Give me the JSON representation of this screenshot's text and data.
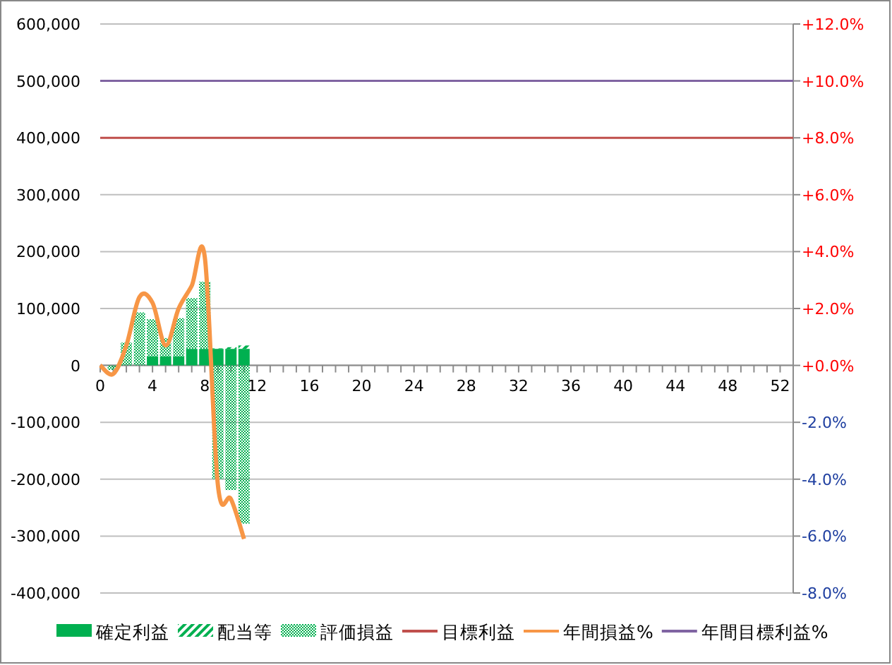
{
  "chart_data": {
    "type": "bar",
    "stacked": true,
    "grid": true,
    "legend": true,
    "x": [
      0,
      1,
      2,
      3,
      4,
      5,
      6,
      7,
      8,
      9,
      10,
      11,
      12,
      13,
      14,
      15,
      16,
      17,
      18,
      19,
      20,
      21,
      22,
      23,
      24,
      25,
      26,
      27,
      28,
      29,
      30,
      31,
      32,
      33,
      34,
      35,
      36,
      37,
      38,
      39,
      40,
      41,
      42,
      43,
      44,
      45,
      46,
      47,
      48,
      49,
      50,
      51,
      52,
      53
    ],
    "xlim": [
      0,
      53
    ],
    "xticks": [
      0,
      4,
      8,
      12,
      16,
      20,
      24,
      28,
      32,
      36,
      40,
      44,
      48,
      52
    ],
    "ylim": [
      -400000,
      600000
    ],
    "yticks": [
      {
        "value": -400000,
        "label": "-400,000"
      },
      {
        "value": -300000,
        "label": "-300,000"
      },
      {
        "value": -200000,
        "label": "-200,000"
      },
      {
        "value": -100000,
        "label": "-100,000"
      },
      {
        "value": 0,
        "label": "0"
      },
      {
        "value": 100000,
        "label": "100,000"
      },
      {
        "value": 200000,
        "label": "200,000"
      },
      {
        "value": 300000,
        "label": "300,000"
      },
      {
        "value": 400000,
        "label": "400,000"
      },
      {
        "value": 500000,
        "label": "500,000"
      },
      {
        "value": 600000,
        "label": "600,000"
      }
    ],
    "y2lim": [
      -8,
      12
    ],
    "y2ticks": [
      {
        "value": -8,
        "label": "-8.0%"
      },
      {
        "value": -6,
        "label": "-6.0%"
      },
      {
        "value": -4,
        "label": "-4.0%"
      },
      {
        "value": -2,
        "label": "-2.0%"
      },
      {
        "value": 0,
        "label": "+0.0%"
      },
      {
        "value": 2,
        "label": "+2.0%"
      },
      {
        "value": 4,
        "label": "+4.0%"
      },
      {
        "value": 6,
        "label": "+6.0%"
      },
      {
        "value": 8,
        "label": "+8.0%"
      },
      {
        "value": 10,
        "label": "+10.0%"
      },
      {
        "value": 12,
        "label": "+12.0%"
      }
    ],
    "series": [
      {
        "name": "確定利益",
        "color": "#00b050",
        "values": [
          null,
          0,
          0,
          0,
          16000,
          16000,
          16000,
          29000,
          29000,
          29000,
          29000,
          29000,
          null,
          null,
          null,
          null,
          null,
          null,
          null,
          null,
          null,
          null,
          null,
          null,
          null,
          null,
          null,
          null,
          null,
          null,
          null,
          null,
          null,
          null,
          null,
          null,
          null,
          null,
          null,
          null,
          null,
          null,
          null,
          null,
          null,
          null,
          null,
          null,
          null,
          null,
          null,
          null,
          null,
          null
        ]
      },
      {
        "name": "配当等",
        "color": "#00b050",
        "values": [
          null,
          0,
          0,
          0,
          0,
          0,
          0,
          0,
          0,
          1000,
          3000,
          6000,
          null,
          null,
          null,
          null,
          null,
          null,
          null,
          null,
          null,
          null,
          null,
          null,
          null,
          null,
          null,
          null,
          null,
          null,
          null,
          null,
          null,
          null,
          null,
          null,
          null,
          null,
          null,
          null,
          null,
          null,
          null,
          null,
          null,
          null,
          null,
          null,
          null,
          null,
          null,
          null,
          null,
          null
        ]
      },
      {
        "name": "評価損益",
        "color": "#00b050",
        "values": [
          null,
          -8000,
          40000,
          93000,
          65000,
          32000,
          67000,
          89000,
          118000,
          -200000,
          -219000,
          -278000,
          null,
          null,
          null,
          null,
          null,
          null,
          null,
          null,
          null,
          null,
          null,
          null,
          null,
          null,
          null,
          null,
          null,
          null,
          null,
          null,
          null,
          null,
          null,
          null,
          null,
          null,
          null,
          null,
          null,
          null,
          null,
          null,
          null,
          null,
          null,
          null,
          null,
          null,
          null,
          null,
          null,
          null
        ]
      },
      {
        "name": "目標利益",
        "type": "line",
        "color": "#c0504d",
        "values": [
          400000,
          400000,
          400000,
          400000,
          400000,
          400000,
          400000,
          400000,
          400000,
          400000,
          400000,
          400000,
          400000,
          400000,
          400000,
          400000,
          400000,
          400000,
          400000,
          400000,
          400000,
          400000,
          400000,
          400000,
          400000,
          400000,
          400000,
          400000,
          400000,
          400000,
          400000,
          400000,
          400000,
          400000,
          400000,
          400000,
          400000,
          400000,
          400000,
          400000,
          400000,
          400000,
          400000,
          400000,
          400000,
          400000,
          400000,
          400000,
          400000,
          400000,
          400000,
          400000,
          400000,
          400000
        ]
      },
      {
        "name": "年間損益%",
        "type": "line",
        "axis": "y2",
        "color": "#f79646",
        "values": [
          0,
          -0.3,
          0.7,
          2.4,
          2.2,
          0.7,
          2,
          2.8,
          3.8,
          -4.2,
          -4.7,
          -6.1,
          null,
          null,
          null,
          null,
          null,
          null,
          null,
          null,
          null,
          null,
          null,
          null,
          null,
          null,
          null,
          null,
          null,
          null,
          null,
          null,
          null,
          null,
          null,
          null,
          null,
          null,
          null,
          null,
          null,
          null,
          null,
          null,
          null,
          null,
          null,
          null,
          null,
          null,
          null,
          null,
          null,
          null
        ]
      },
      {
        "name": "年間目標利益%",
        "type": "line",
        "axis": "y2",
        "color": "#8064a2",
        "values": [
          10,
          10,
          10,
          10,
          10,
          10,
          10,
          10,
          10,
          10,
          10,
          10,
          10,
          10,
          10,
          10,
          10,
          10,
          10,
          10,
          10,
          10,
          10,
          10,
          10,
          10,
          10,
          10,
          10,
          10,
          10,
          10,
          10,
          10,
          10,
          10,
          10,
          10,
          10,
          10,
          10,
          10,
          10,
          10,
          10,
          10,
          10,
          10,
          10,
          10,
          10,
          10,
          10,
          10
        ]
      }
    ]
  }
}
